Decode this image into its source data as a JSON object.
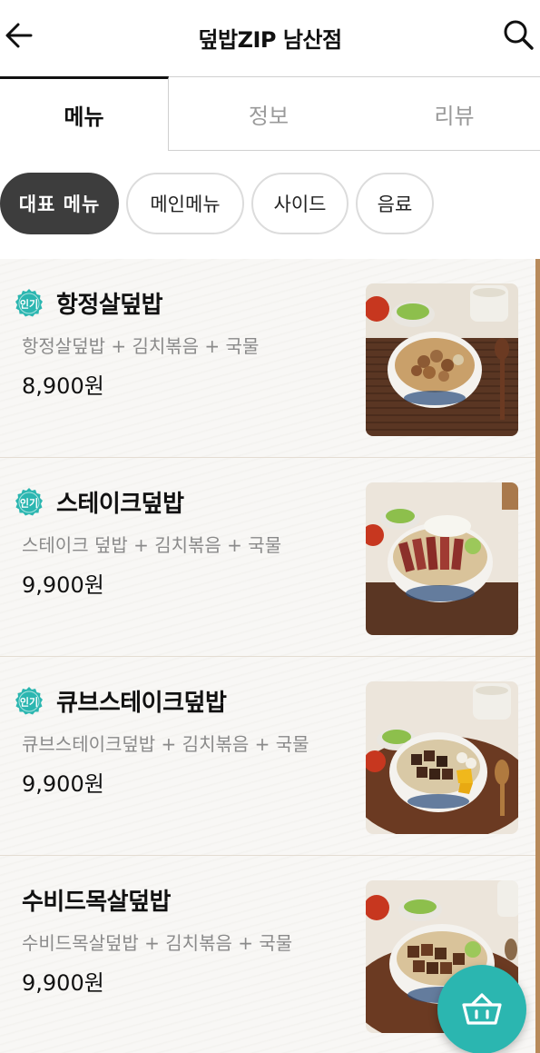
{
  "header": {
    "title": "덮밥ZIP 남산점",
    "back_icon": "arrow-left-icon",
    "search_icon": "search-icon"
  },
  "tabs": [
    {
      "label": "메뉴",
      "active": true
    },
    {
      "label": "정보",
      "active": false
    },
    {
      "label": "리뷰",
      "active": false
    }
  ],
  "categories": [
    {
      "label": "대표 메뉴",
      "selected": true
    },
    {
      "label": "메인메뉴",
      "selected": false
    },
    {
      "label": "사이드",
      "selected": false
    },
    {
      "label": "음료",
      "selected": false
    }
  ],
  "menu_items": [
    {
      "badge": "인기",
      "name": "항정살덮밥",
      "description": "항정살덮밥 + 김치볶음 + 국물",
      "price": "8,900원"
    },
    {
      "badge": "인기",
      "name": "스테이크덮밥",
      "description": "스테이크 덮밥 + 김치볶음 + 국물",
      "price": "9,900원"
    },
    {
      "badge": "인기",
      "name": "큐브스테이크덮밥",
      "description": "큐브스테이크덮밥 + 김치볶음 + 국물",
      "price": "9,900원"
    },
    {
      "badge": "",
      "name": "수비드목살덮밥",
      "description": "수비드목살덮밥 + 김치볶음 + 국물",
      "price": "9,900원"
    }
  ],
  "cart_icon": "basket-icon",
  "colors": {
    "accent": "#2bb6b0",
    "chip_selected": "#3d3d3d",
    "list_edge": "#b88a5a"
  }
}
